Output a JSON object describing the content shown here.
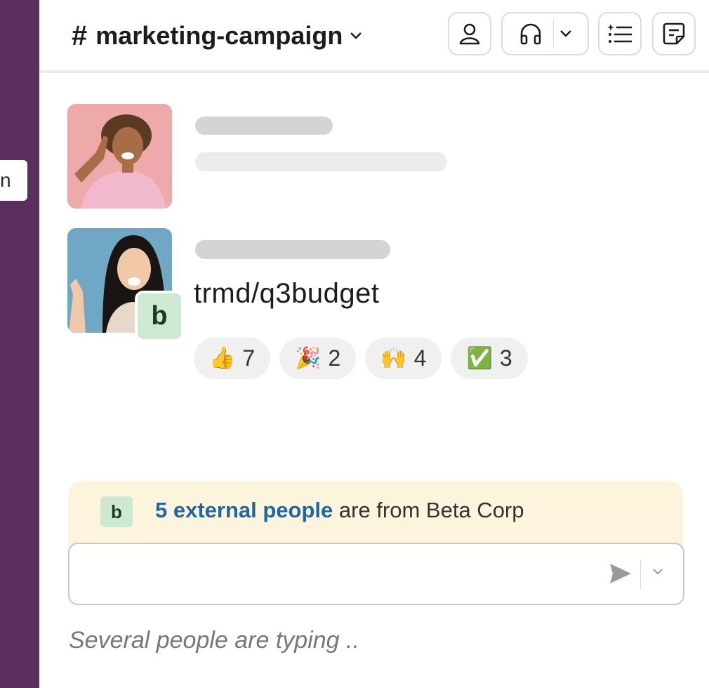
{
  "sidebar": {
    "tab_label": "n"
  },
  "header": {
    "channel_hash": "#",
    "channel_name": "marketing-campaign",
    "icons": [
      "person-icon",
      "headphones-icon",
      "chevron-down-icon",
      "list-icon",
      "notes-icon"
    ]
  },
  "messages": [
    {
      "avatar": "woman-pink-background",
      "skeleton": true
    },
    {
      "avatar": "woman-blue-background",
      "org_badge": "b",
      "text": "trmd/q3budget",
      "reactions": [
        {
          "emoji": "👍",
          "count": "7"
        },
        {
          "emoji": "🎉",
          "count": "2"
        },
        {
          "emoji": "🙌",
          "count": "4"
        },
        {
          "emoji": "✅",
          "count": "3"
        }
      ]
    }
  ],
  "banner": {
    "badge": "b",
    "link": "5 external people",
    "text": " are from Beta Corp"
  },
  "composer": {
    "value": ""
  },
  "typing": "Several people are typing  .."
}
